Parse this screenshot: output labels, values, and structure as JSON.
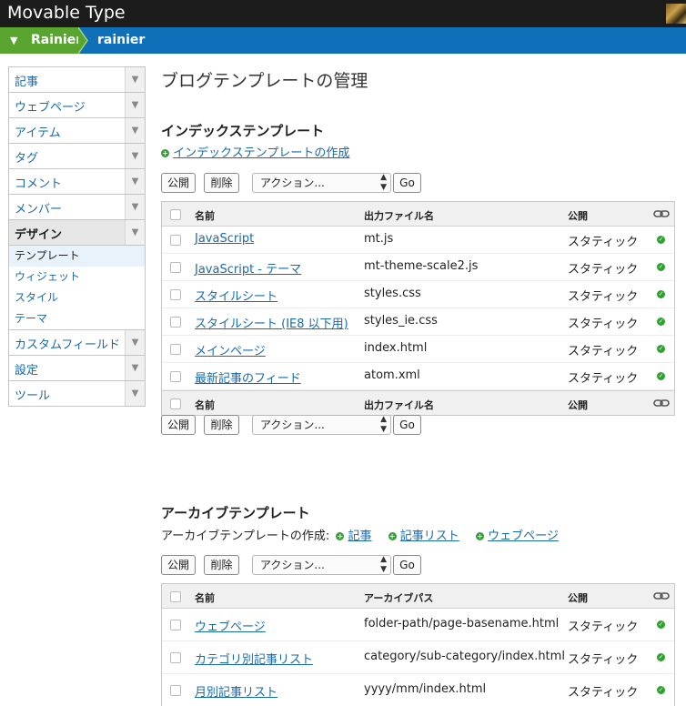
{
  "app": {
    "title": "Movable Type"
  },
  "breadcrumb": {
    "site": "Rainier",
    "blog": "rainier"
  },
  "sidebar": {
    "items": [
      {
        "label": "記事"
      },
      {
        "label": "ウェブページ"
      },
      {
        "label": "アイテム"
      },
      {
        "label": "タグ"
      },
      {
        "label": "コメント"
      },
      {
        "label": "メンバー"
      },
      {
        "label": "デザイン"
      },
      {
        "label": "カスタムフィールド"
      },
      {
        "label": "設定"
      },
      {
        "label": "ツール"
      }
    ],
    "design_sub": [
      {
        "label": "テンプレート"
      },
      {
        "label": "ウィジェット"
      },
      {
        "label": "スタイル"
      },
      {
        "label": "テーマ"
      }
    ]
  },
  "main": {
    "title": "ブログテンプレートの管理",
    "index_section": {
      "heading": "インデックステンプレート",
      "create_link": "インデックステンプレートの作成",
      "actions": {
        "publish": "公開",
        "delete": "削除",
        "select": "アクション...",
        "go": "Go"
      },
      "columns": {
        "name": "名前",
        "output": "出力ファイル名",
        "publish": "公開"
      },
      "rows": [
        {
          "name": "JavaScript",
          "output": "mt.js",
          "publish": "スタティック"
        },
        {
          "name": "JavaScript - テーマ",
          "output": "mt-theme-scale2.js",
          "publish": "スタティック"
        },
        {
          "name": "スタイルシート",
          "output": "styles.css",
          "publish": "スタティック"
        },
        {
          "name": "スタイルシート (IE8 以下用)",
          "output": "styles_ie.css",
          "publish": "スタティック"
        },
        {
          "name": "メインページ",
          "output": "index.html",
          "publish": "スタティック"
        },
        {
          "name": "最新記事のフィード",
          "output": "atom.xml",
          "publish": "スタティック"
        }
      ]
    },
    "archive_section": {
      "heading": "アーカイブテンプレート",
      "create_prefix": "アーカイブテンプレートの作成:",
      "create_links": [
        "記事",
        "記事リスト",
        "ウェブページ"
      ],
      "actions": {
        "publish": "公開",
        "delete": "削除",
        "select": "アクション...",
        "go": "Go"
      },
      "columns": {
        "name": "名前",
        "path": "アーカイブパス",
        "publish": "公開"
      },
      "rows": [
        {
          "name": "ウェブページ",
          "path": "folder-path/page-basename.html",
          "publish": "スタティック"
        },
        {
          "name": "カテゴリ別記事リスト",
          "path": "category/sub-category/index.html",
          "publish": "スタティック"
        },
        {
          "name": "月別記事リスト",
          "path": "yyyy/mm/index.html",
          "publish": "スタティック"
        }
      ]
    }
  },
  "colors": {
    "topbar": "#1c1c1c",
    "crumbbar": "#0f6fb9",
    "site": "#59a52f",
    "link": "#1a6aa8",
    "ok": "#2fa12f"
  }
}
